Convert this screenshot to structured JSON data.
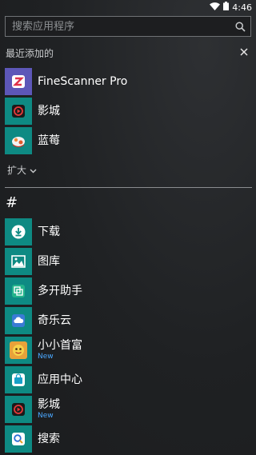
{
  "status": {
    "time": "4:46"
  },
  "search": {
    "placeholder": "搜索应用程序"
  },
  "recent": {
    "header": "最近添加的",
    "items": [
      {
        "name": "FineScanner Pro",
        "sub": "",
        "icon": "finescanner-icon"
      },
      {
        "name": "影城",
        "sub": "",
        "icon": "movie-icon"
      },
      {
        "name": "蓝莓",
        "sub": "",
        "icon": "blueberry-icon"
      }
    ],
    "expand_label": "扩大"
  },
  "group": {
    "label": "#"
  },
  "apps": [
    {
      "name": "下载",
      "sub": "",
      "icon": "download-icon"
    },
    {
      "name": "图库",
      "sub": "",
      "icon": "gallery-icon"
    },
    {
      "name": "多开助手",
      "sub": "",
      "icon": "dual-app-icon"
    },
    {
      "name": "奇乐云",
      "sub": "",
      "icon": "cloud-icon"
    },
    {
      "name": "小小首富",
      "sub": "New",
      "icon": "game-icon"
    },
    {
      "name": "应用中心",
      "sub": "",
      "icon": "app-center-icon"
    },
    {
      "name": "影城",
      "sub": "New",
      "icon": "movie-icon"
    },
    {
      "name": "搜索",
      "sub": "",
      "icon": "search-app-icon"
    }
  ],
  "colors": {
    "tile": "#0e8a83",
    "tile_purple": "#5d57b8",
    "new_badge": "#4aa8ff"
  }
}
